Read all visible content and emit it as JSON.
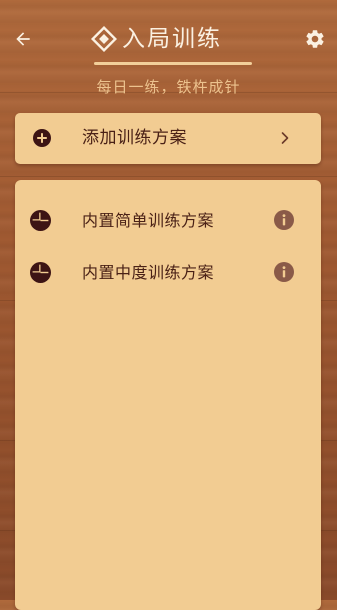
{
  "header": {
    "title": "入局训练",
    "subtitle": "每日一练，铁杵成针",
    "back_icon": "arrow-left-icon",
    "settings_icon": "gear-icon",
    "title_icon": "diamond-icon"
  },
  "add_plan": {
    "label": "添加训练方案",
    "icon": "plus-circle-icon",
    "chevron_icon": "chevron-right-icon"
  },
  "plans": [
    {
      "label": "内置简单训练方案",
      "icon": "pie-chart-icon",
      "info_icon": "info-icon"
    },
    {
      "label": "内置中度训练方案",
      "icon": "pie-chart-icon",
      "info_icon": "info-icon"
    }
  ],
  "colors": {
    "panel": "#f2cc92",
    "text_dark": "#4a2116",
    "icon_dark": "#3d1414",
    "info_icon": "#8a5a48",
    "subtitle": "#ecc28e",
    "title": "#fbf1e2",
    "wood_top": "#b06a3c",
    "wood_bottom": "#8a4a2a"
  }
}
